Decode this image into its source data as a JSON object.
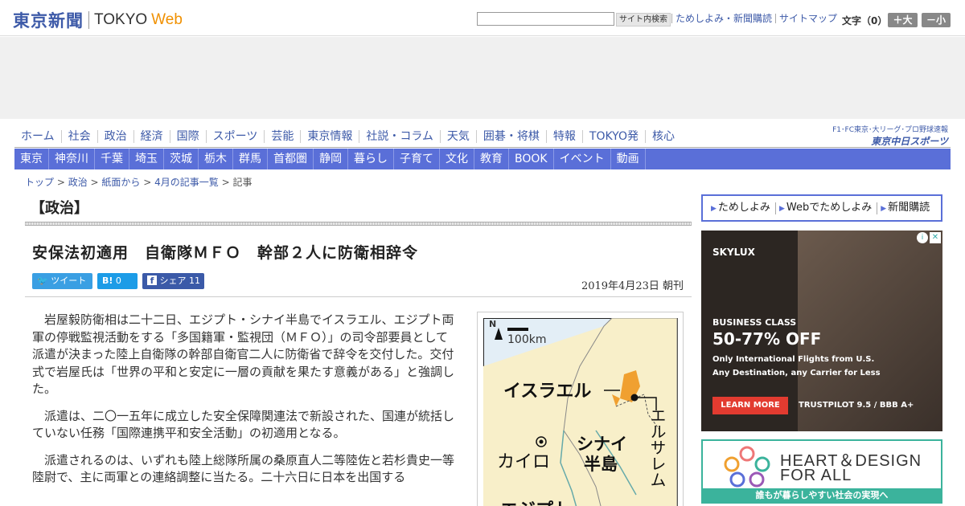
{
  "header": {
    "logo_jp": "東京新聞",
    "logo_tokyo": "TOKYO",
    "logo_web": "Web",
    "search_button": "サイト内検索",
    "links": [
      "ためしよみ・新聞購読",
      "サイトマップ"
    ],
    "font_size_label": "文字（0）",
    "font_bigger": "＋大",
    "font_smaller": "－小"
  },
  "nav_primary": [
    "ホーム",
    "社会",
    "政治",
    "経済",
    "国際",
    "スポーツ",
    "芸能",
    "東京情報",
    "社説・コラム",
    "天気",
    "囲碁・将棋",
    "特報",
    "TOKYO発",
    "核心"
  ],
  "chunichi": {
    "top": "F1･FC東京･大リーグ･プロ野球速報",
    "bottom": "東京中日スポーツ"
  },
  "nav_regional": [
    "東京",
    "神奈川",
    "千葉",
    "埼玉",
    "茨城",
    "栃木",
    "群馬",
    "首都圏",
    "静岡",
    "暮らし",
    "子育て",
    "文化",
    "教育",
    "BOOK",
    "イベント",
    "動画"
  ],
  "breadcrumb": {
    "items": [
      "トップ",
      "政治",
      "紙面から",
      "4月の記事一覧"
    ],
    "current": "記事",
    "sep": " > "
  },
  "article": {
    "section": "【政治】",
    "headline": "安保法初適用　自衛隊ＭＦＯ　幹部２人に防衛相辞令",
    "share": {
      "tweet": "ツイート",
      "hatena": "0",
      "facebook": "シェア 11"
    },
    "dateline": "2019年4月23日 朝刊",
    "paragraphs": [
      "岩屋毅防衛相は二十二日、エジプト・シナイ半島でイスラエル、エジプト両軍の停戦監視活動をする「多国籍軍・監視団（ＭＦＯ）」の司令部要員として派遣が決まった陸上自衛隊の幹部自衛官二人に防衛省で辞令を交付した。交付式で岩屋氏は「世界の平和と安定に一層の貢献を果たす意義がある」と強調した。",
      "派遣は、二〇一五年に成立した安全保障関連法で新設された、国連が統括していない任務「国際連携平和安全活動」の初適用となる。",
      "派遣されるのは、いずれも陸上総隊所属の桑原直人二等陸佐と若杉貴史一等陸尉で、主に両軍との連絡調整に当たる。二十六日に日本を出国する"
    ]
  },
  "map": {
    "scale": "100km",
    "north": "N",
    "israel": "イスラエル",
    "jerusalem": "エルサレム",
    "cairo": "カイロ",
    "sinai_1": "シナイ",
    "sinai_2": "半島",
    "egypt": "エジプト"
  },
  "sidebar": {
    "links": [
      "ためしよみ",
      "Webでためしよみ",
      "新聞購読"
    ],
    "ad": {
      "brand": "SKYLUX",
      "class": "BUSINESS CLASS",
      "pct": "50-77% OFF",
      "line1": "Only International Flights from U.S.",
      "line2": "Any Destination, any Carrier for Less",
      "cta": "LEARN MORE",
      "trust": "TRUSTPILOT 9.5 / BBB A+"
    },
    "banner": {
      "line1": "HEART＆DESIGN",
      "line2": "FOR ALL",
      "sub": "誰もが暮らしやすい社会の実現へ"
    }
  }
}
